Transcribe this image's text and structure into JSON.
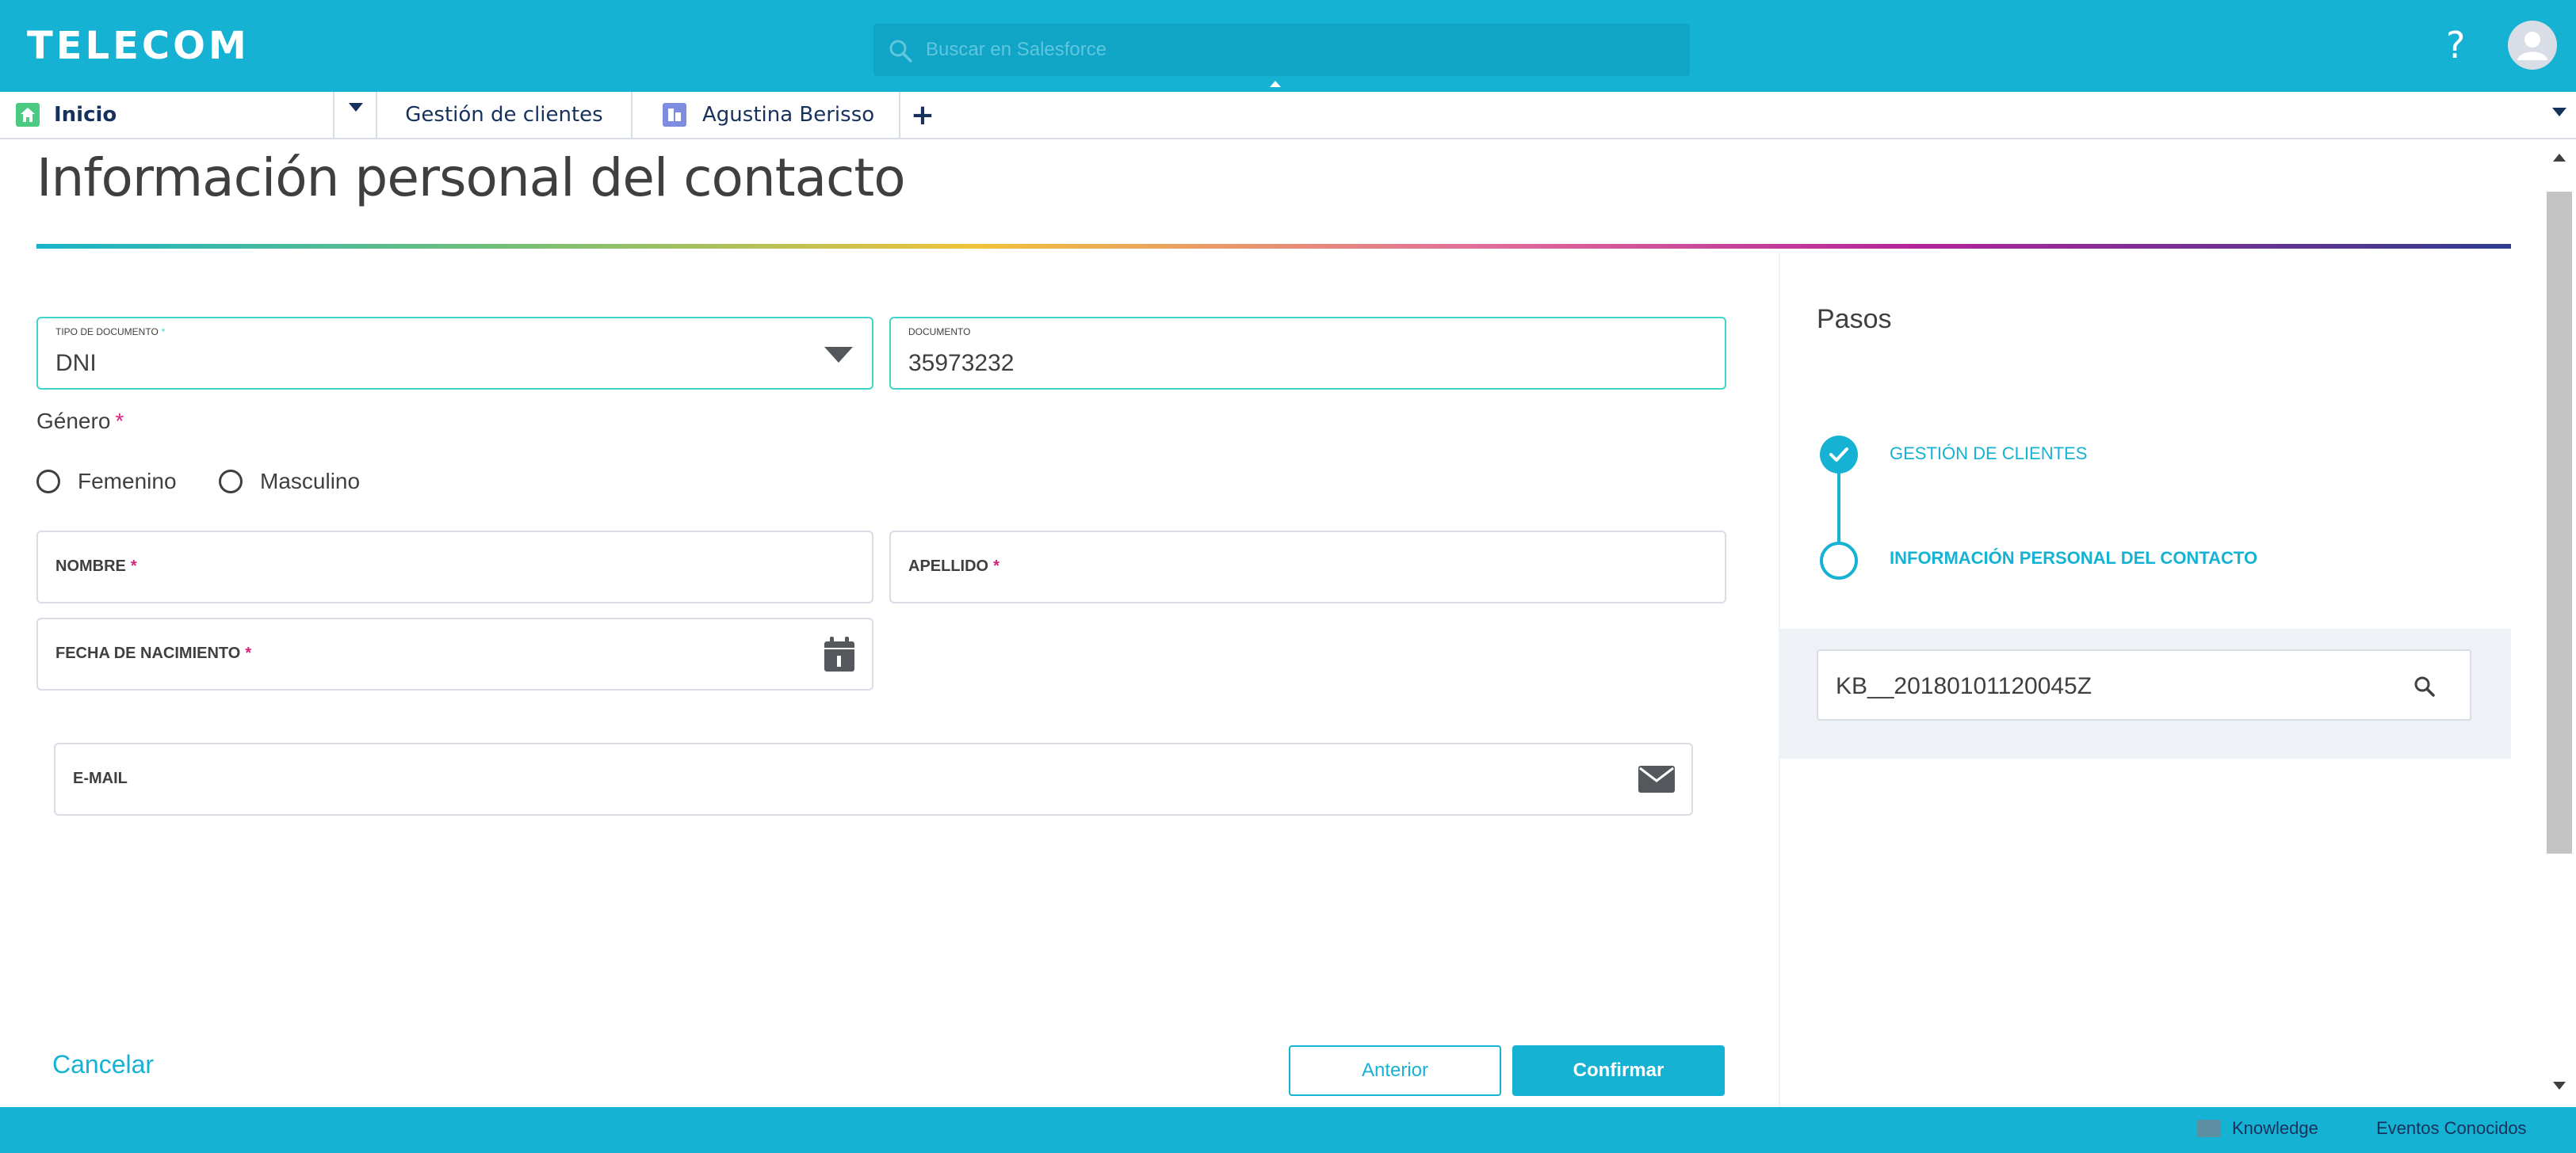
{
  "header": {
    "logo": "TELECOM",
    "search_placeholder": "Buscar en Salesforce",
    "help_label": "?"
  },
  "tabs": {
    "home_label": "Inicio",
    "tab1_label": "Gestión de clientes",
    "tab2_label": "Agustina Berisso",
    "add_label": "+"
  },
  "form": {
    "title": "Información personal del contacto",
    "tipo_documento": {
      "label": "TIPO DE DOCUMENTO",
      "required": "*",
      "value": "DNI"
    },
    "documento": {
      "label": "DOCUMENTO",
      "value": "35973232"
    },
    "genero": {
      "label": "Género",
      "required": "*",
      "options": [
        "Femenino",
        "Masculino"
      ]
    },
    "nombre": {
      "label": "NOMBRE",
      "required": "*"
    },
    "apellido": {
      "label": "APELLIDO",
      "required": "*"
    },
    "fecha_nacimiento": {
      "label": "FECHA DE NACIMIENTO",
      "required": "*"
    },
    "email": {
      "label": "E-MAIL"
    },
    "cancel_label": "Cancelar",
    "prev_label": "Anterior",
    "confirm_label": "Confirmar"
  },
  "steps": {
    "title": "Pasos",
    "items": [
      {
        "label": "GESTIÓN DE CLIENTES",
        "status": "done"
      },
      {
        "label": "INFORMACIÓN PERSONAL DEL CONTACTO",
        "status": "current"
      }
    ],
    "kb_value": "KB__20180101120045Z"
  },
  "footer": {
    "knowledge_label": "Knowledge",
    "eventos_label": "Eventos Conocidos"
  },
  "colors": {
    "brand": "#16b2d4",
    "required": "#d4237a",
    "active_border": "#3fd6c8"
  }
}
